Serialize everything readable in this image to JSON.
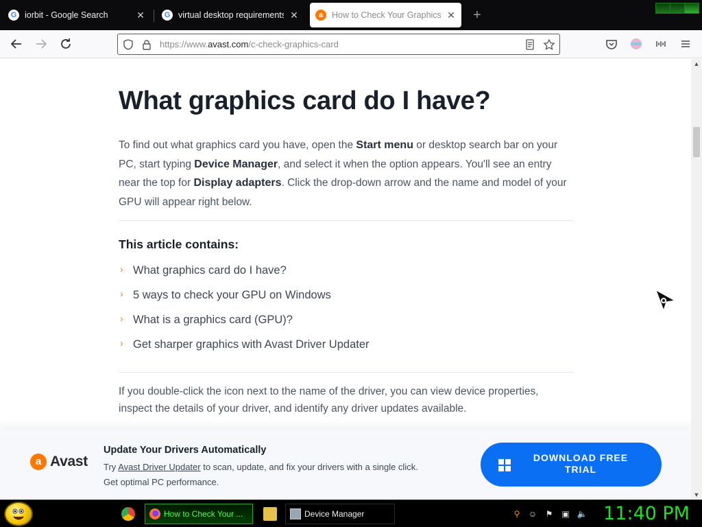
{
  "browser": {
    "tabs": [
      {
        "title": "iorbit - Google Search",
        "favicon": "google-icon"
      },
      {
        "title": "virtual desktop requirements - G",
        "favicon": "google-icon"
      },
      {
        "title": "How to Check Your Graphics C",
        "favicon": "avast-icon"
      }
    ],
    "new_tab": "+",
    "close_glyph": "✕",
    "url": {
      "prefix": "https://www.",
      "domain": "avast.com",
      "path": "/c-check-graphics-card"
    }
  },
  "article": {
    "title": "What graphics card do I have?",
    "intro_parts": [
      "To find out what graphics card you have, open the ",
      "Start menu",
      " or desktop search bar on your PC, start typing ",
      "Device Manager",
      ", and select it when the option appears. You'll see an entry near the top for ",
      "Display adapters",
      ". Click the drop-down arrow and the name and model of your GPU will appear right below."
    ],
    "contains_heading": "This article contains:",
    "toc": [
      "What graphics card do I have?",
      "5 ways to check your GPU on Windows",
      "What is a graphics card (GPU)?",
      "Get sharper graphics with Avast Driver Updater"
    ],
    "paragraph2": "If you double-click the icon next to the name of the driver, you can view device properties, inspect the details of your driver, and identify any driver updates available."
  },
  "promo": {
    "logo_text": "Avast",
    "title": "Update Your Drivers Automatically",
    "text_before": "Try ",
    "link": "Avast Driver Updater",
    "text_after": " to scan, update, and fix your drivers with a single click. Get optimal PC performance.",
    "button": "DOWNLOAD FREE TRIAL"
  },
  "taskbar": {
    "items": [
      {
        "label": "How to Check Your ...",
        "active": true
      },
      {
        "label": "Device Manager",
        "active": false
      }
    ],
    "clock": "11:40 PM"
  },
  "colors": {
    "accent": "#ff7800",
    "button": "#0b6ff3",
    "clock": "#1ee11e"
  }
}
